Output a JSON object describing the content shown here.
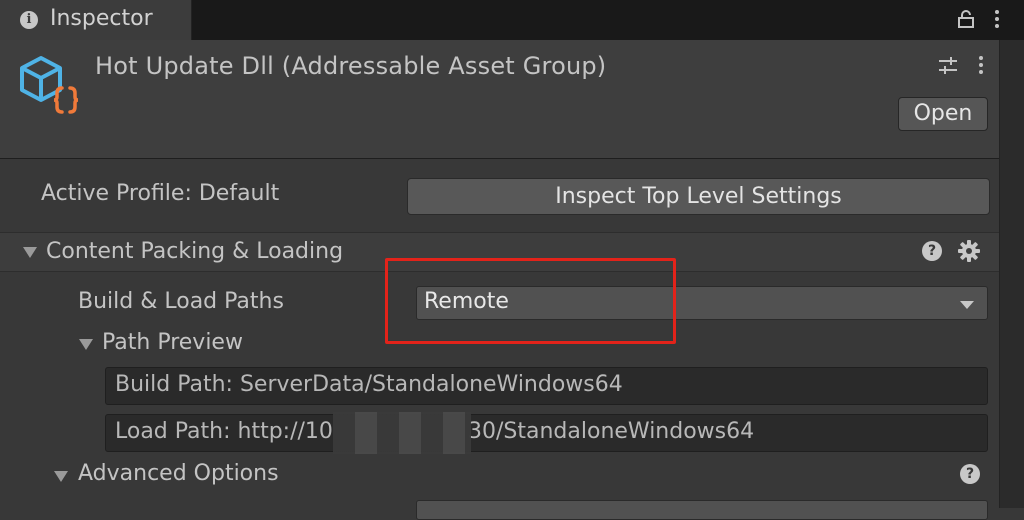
{
  "window": {
    "tab_title": "Inspector"
  },
  "header": {
    "asset_title": "Hot Update Dll (Addressable Asset Group)",
    "open_label": "Open"
  },
  "profile": {
    "label": "Active Profile: Default",
    "inspect_button": "Inspect Top Level Settings"
  },
  "section": {
    "title": "Content Packing & Loading"
  },
  "build_load": {
    "label": "Build & Load Paths",
    "selected": "Remote"
  },
  "path_preview": {
    "label": "Path Preview",
    "build_path": "Build Path: ServerData/StandaloneWindows64",
    "load_path_prefix": "Load Path: http://10",
    "load_path_suffix": "30/StandaloneWindows64"
  },
  "advanced": {
    "label": "Advanced Options"
  },
  "icons": {
    "tab": "info-icon",
    "lock": "lock-icon",
    "menu": "kebab-menu-icon",
    "preset": "preset-sliders-icon",
    "help": "help-icon",
    "settings": "gear-icon",
    "asset": "cube-braces-icon"
  },
  "colors": {
    "highlight": "#e3231a",
    "asset_icon_blue": "#4fb3e6",
    "asset_icon_orange": "#f07a3a"
  }
}
